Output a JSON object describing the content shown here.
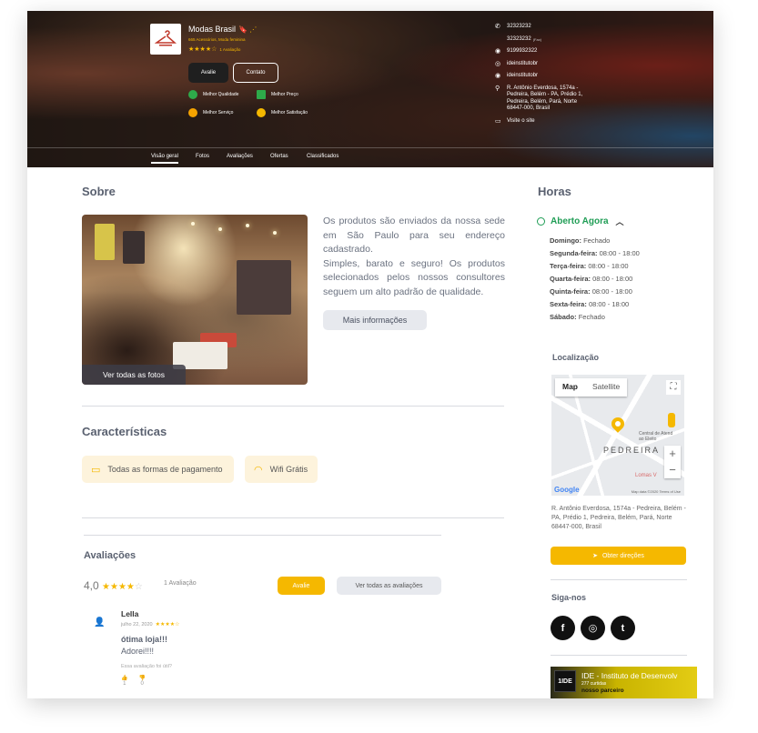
{
  "header": {
    "store_name": "Modas Brasil",
    "category": "665 Acessórios, Moda feminina",
    "stars": "★★★★☆",
    "rating_count": "1 Avaliação",
    "btn_avalie": "Avalie",
    "btn_contato": "Contato",
    "badges": [
      "Melhor Qualidade",
      "Melhor Preço",
      "Melhor Serviço",
      "Melhor Satisfação"
    ],
    "badge_colors": [
      "#2eaa4a",
      "#2eaa4a",
      "#f5a300",
      "#f5b800"
    ]
  },
  "contacts": {
    "phone1": "32323232",
    "phone2": "32323232",
    "phone2_sub": "(Fax)",
    "whatsapp": "9199932322",
    "instagram": "ideinstitutobr",
    "twitter": "ideinstitutobr",
    "address": "R. Antônio Everdosa, 1574a - Pedreira, Belém - PA, Prédio 1, Pedreira, Belém, Pará, Norte 68447-000, Brasil",
    "website": "Visite o site"
  },
  "tabs": [
    "Visão geral",
    "Fotos",
    "Avaliações",
    "Ofertas",
    "Classificados"
  ],
  "about": {
    "title": "Sobre",
    "text": "Os produtos são enviados da nossa sede em São Paulo para seu endereço cadastrado.\nSimples, barato e seguro! Os produtos selecionados pelos nossos consultores seguem um alto padrão de qualidade.",
    "more_button": "Mais informações",
    "photos_button": "Ver todas as fotos"
  },
  "features": {
    "title": "Características",
    "items": [
      "Todas as formas de pagamento",
      "Wifi Grátis"
    ]
  },
  "reviews": {
    "title": "Avaliações",
    "score": "4,0",
    "stars_full": "★★★★",
    "stars_empty": "☆",
    "count": "1 Avaliação",
    "btn_avalie": "Avalie",
    "btn_all": "Ver todas as avaliações",
    "items": [
      {
        "name": "Lella",
        "date": "julho 22, 2020",
        "stars": "★★★★☆",
        "title": "ótima loja!!!",
        "body": "Adorei!!!!",
        "useful": "Essa avaliação foi útil?",
        "likes": "1",
        "dislikes": "0"
      }
    ]
  },
  "hours": {
    "title": "Horas",
    "status": "Aberto Agora",
    "days": [
      {
        "day": "Domingo:",
        "time": "Fechado"
      },
      {
        "day": "Segunda-feira:",
        "time": "08:00 - 18:00"
      },
      {
        "day": "Terça-feira:",
        "time": "08:00 - 18:00"
      },
      {
        "day": "Quarta-feira:",
        "time": "08:00 - 18:00"
      },
      {
        "day": "Quinta-feira:",
        "time": "08:00 - 18:00"
      },
      {
        "day": "Sexta-feira:",
        "time": "08:00 - 18:00"
      },
      {
        "day": "Sábado:",
        "time": "Fechado"
      }
    ]
  },
  "location": {
    "title": "Localização",
    "map_tab": "Map",
    "satellite_tab": "Satellite",
    "map_label": "PEDREIRA",
    "map_label2": "Central de Atend\nao Eleito",
    "map_red": "Lomas V",
    "google": "Google",
    "map_copy": "Map data ©2020   Terms of Use",
    "address": "R. Antônio Everdosa, 1574a - Pedreira, Belém - PA, Prédio 1, Pedreira, Belém, Pará, Norte 68447-000, Brasil",
    "directions_button": "Obter direções"
  },
  "social": {
    "title": "Siga-nos",
    "items": [
      "f",
      "◎",
      "t"
    ]
  },
  "facebook_card": {
    "logo": "1IDE",
    "name": "IDE - Instituto de Desenvolv",
    "likes": "277 curtidas",
    "tagline": "nosso parceiro"
  }
}
